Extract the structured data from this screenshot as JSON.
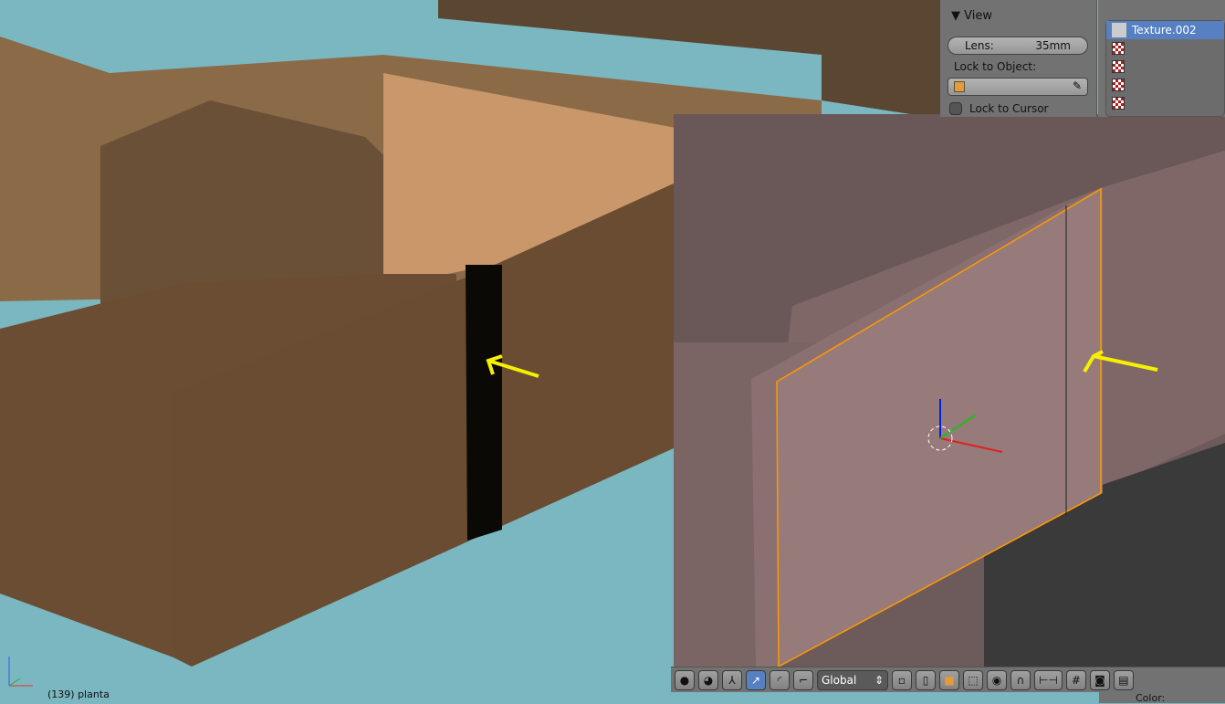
{
  "view_panel": {
    "title": "View",
    "lens_label": "Lens:",
    "lens_value": "35mm",
    "lock_object_label": "Lock to Object:",
    "lock_cursor_label": "Lock to Cursor"
  },
  "texture_list": {
    "items": [
      "Texture.002",
      "",
      "",
      "",
      ""
    ]
  },
  "toolbar": {
    "orientation": "Global"
  },
  "properties": {
    "color_label": "Color:"
  },
  "viewport": {
    "status": "(139) planta"
  },
  "colors": {
    "sky": "#7ab7c1",
    "wall": "#6b4f33",
    "highlight": "#5680c2",
    "selection": "#ff9900"
  }
}
